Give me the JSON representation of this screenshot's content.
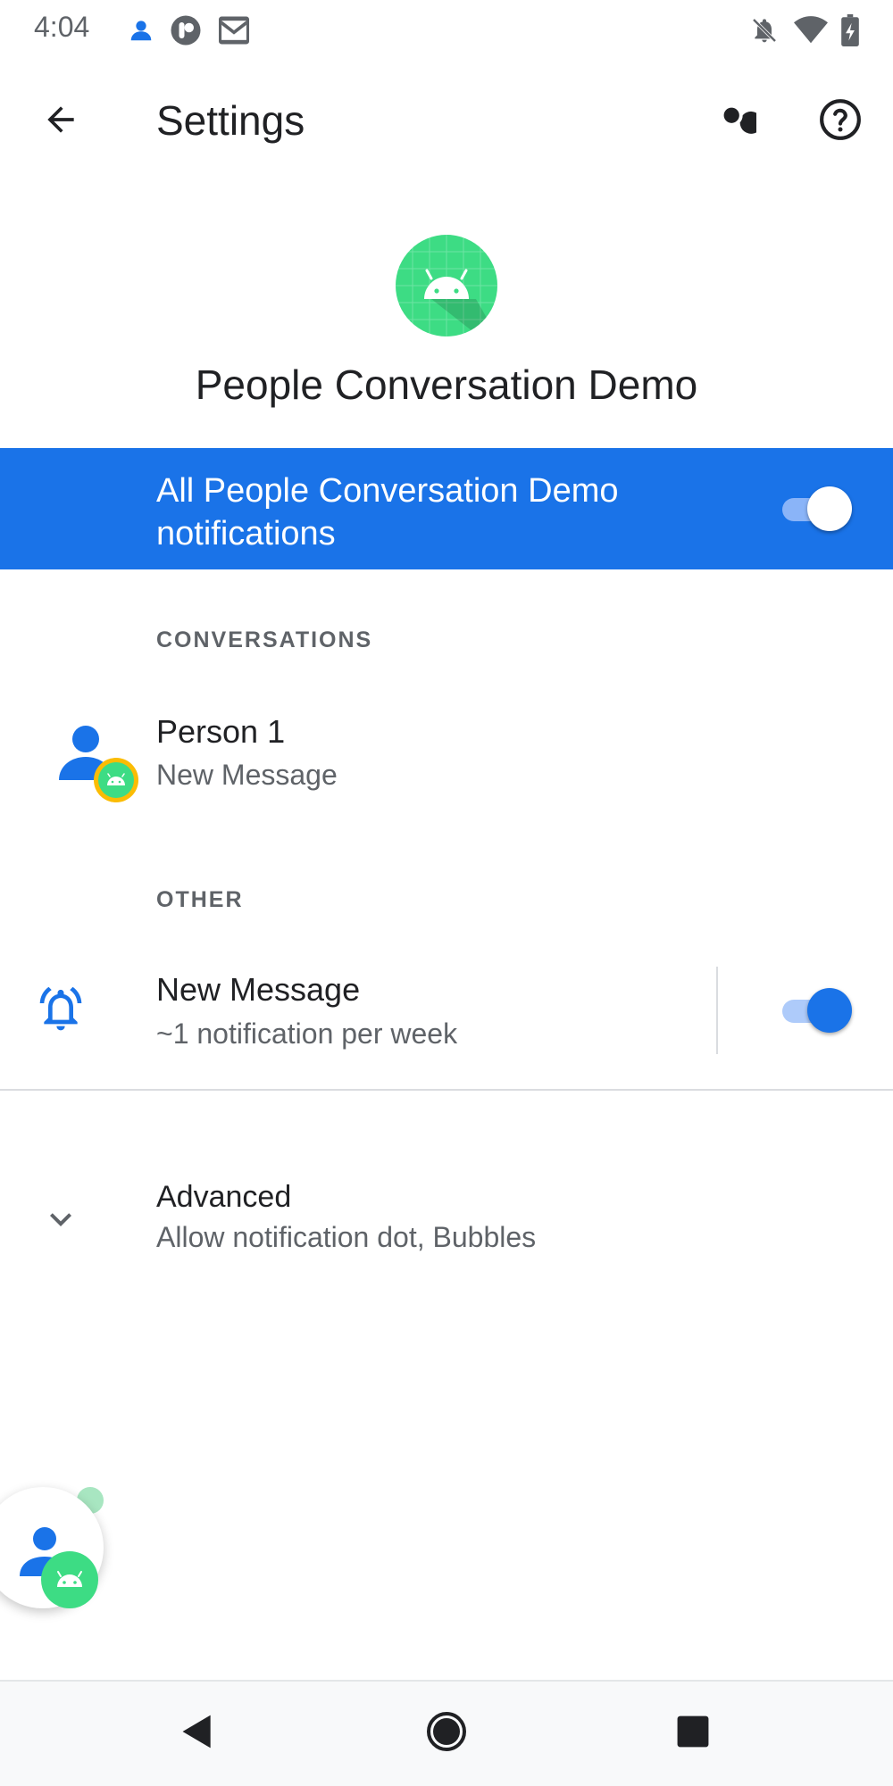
{
  "status_bar": {
    "time": "4:04",
    "left_icons": [
      "person-icon",
      "app-circle-icon",
      "gmail-icon"
    ],
    "right_icons": [
      "notifications-off-icon",
      "wifi-icon",
      "battery-charging-icon"
    ]
  },
  "app_bar": {
    "title": "Settings",
    "back_icon": "arrow-back-icon",
    "search_icon": "search-icon",
    "help_icon": "help-icon"
  },
  "header": {
    "app_name": "People Conversation Demo",
    "app_icon": "android-icon"
  },
  "master_toggle": {
    "label": "All People Conversation Demo notifications",
    "enabled": true,
    "color": "#1a73e8"
  },
  "conversations": {
    "header": "CONVERSATIONS",
    "items": [
      {
        "title": "Person 1",
        "subtitle": "New Message",
        "icon": "person-avatar-icon"
      }
    ]
  },
  "other": {
    "header": "OTHER",
    "items": [
      {
        "title": "New Message",
        "subtitle": "~1 notification per week",
        "icon": "notification-bell-icon",
        "enabled": true
      }
    ]
  },
  "advanced": {
    "title": "Advanced",
    "subtitle": "Allow notification dot, Bubbles",
    "icon": "chevron-down-icon"
  },
  "nav_bar": {
    "back": "nav-back-icon",
    "home": "nav-home-icon",
    "recents": "nav-recents-icon"
  }
}
